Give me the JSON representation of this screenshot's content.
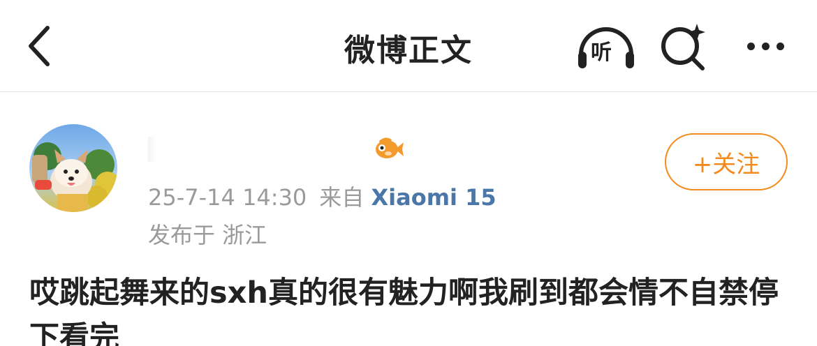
{
  "header": {
    "title": "微博正文",
    "listen_label": "听",
    "back_icon": "chevron-left-icon",
    "search_icon": "sparkle-search-icon",
    "more_icon": "more-dots-icon"
  },
  "post": {
    "author": {
      "avatar_icon": "dog-avatar",
      "badge_icon": "orange-fish-badge-icon"
    },
    "follow_label": "+关注",
    "timestamp": "25-7-14 14:30",
    "source_prefix": "来自",
    "source_device": "Xiaomi 15",
    "location": "发布于 浙江",
    "text": "哎跳起舞来的sxh真的很有魅力啊我刷到都会情不自禁停下看完"
  },
  "colors": {
    "accent": "#f28b1c",
    "link": "#4a76a8",
    "meta": "#9a9a9a",
    "text": "#222222"
  }
}
